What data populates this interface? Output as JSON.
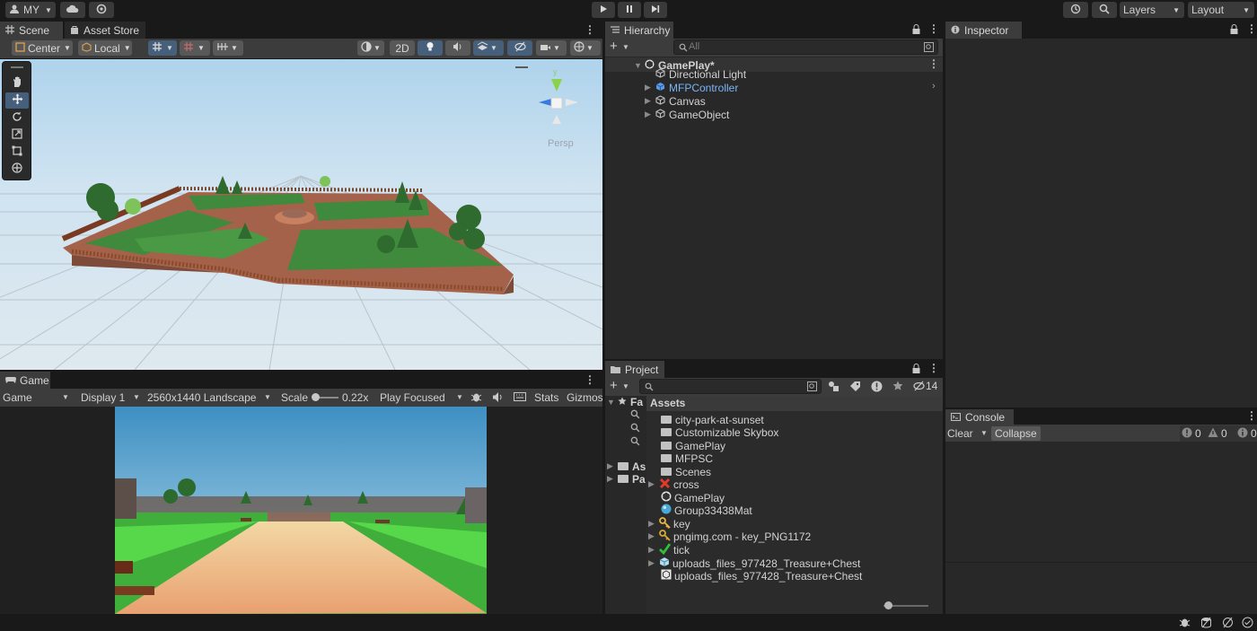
{
  "toolbar": {
    "account_label": "MY",
    "layers_label": "Layers",
    "layout_label": "Layout"
  },
  "scene": {
    "tab_scene": "Scene",
    "tab_asset_store": "Asset Store",
    "pivot_label": "Center",
    "space_label": "Local",
    "mode_2d": "2D",
    "persp_label": "Persp",
    "gizmo_y": "y"
  },
  "game": {
    "tab_label": "Game",
    "mode_select": "Game",
    "display_select": "Display 1",
    "resolution_select": "2560x1440 Landscape",
    "scale_label": "Scale",
    "scale_value": "0.22x",
    "play_focused": "Play Focused",
    "stats_label": "Stats",
    "gizmos_label": "Gizmos"
  },
  "hierarchy": {
    "tab_label": "Hierarchy",
    "search_placeholder": "All",
    "scene_name": "GamePlay*",
    "items": [
      "Directional Light",
      "MFPController",
      "Canvas",
      "GameObject"
    ]
  },
  "inspector": {
    "tab_label": "Inspector"
  },
  "project": {
    "tab_label": "Project",
    "hidden_count": "14",
    "left_tree": [
      "Fa",
      "As",
      "Pa"
    ],
    "assets_header": "Assets",
    "items": [
      {
        "name": "city-park-at-sunset",
        "icon": "folder-icon"
      },
      {
        "name": "Customizable Skybox",
        "icon": "folder-icon"
      },
      {
        "name": "GamePlay",
        "icon": "folder-icon"
      },
      {
        "name": "MFPSC",
        "icon": "folder-icon"
      },
      {
        "name": "Scenes",
        "icon": "folder-icon"
      },
      {
        "name": "cross",
        "icon": "cross-icon"
      },
      {
        "name": "GamePlay",
        "icon": "unity-scene-icon"
      },
      {
        "name": "Group33438Mat",
        "icon": "material-icon"
      },
      {
        "name": "key",
        "icon": "key-icon"
      },
      {
        "name": "pngimg.com - key_PNG1172",
        "icon": "key-icon"
      },
      {
        "name": "tick",
        "icon": "tick-icon"
      },
      {
        "name": "uploads_files_977428_Treasure+Chest",
        "icon": "prefab-icon"
      },
      {
        "name": "uploads_files_977428_Treasure+Chest",
        "icon": "model-icon"
      }
    ]
  },
  "console": {
    "tab_label": "Console",
    "clear_label": "Clear",
    "collapse_label": "Collapse",
    "error_count": "0",
    "warning_count": "0",
    "log_count": "0"
  },
  "colors": {
    "accent_blue": "#46607c",
    "selected_text": "#7cb4f5",
    "panel_bg": "#282828"
  }
}
